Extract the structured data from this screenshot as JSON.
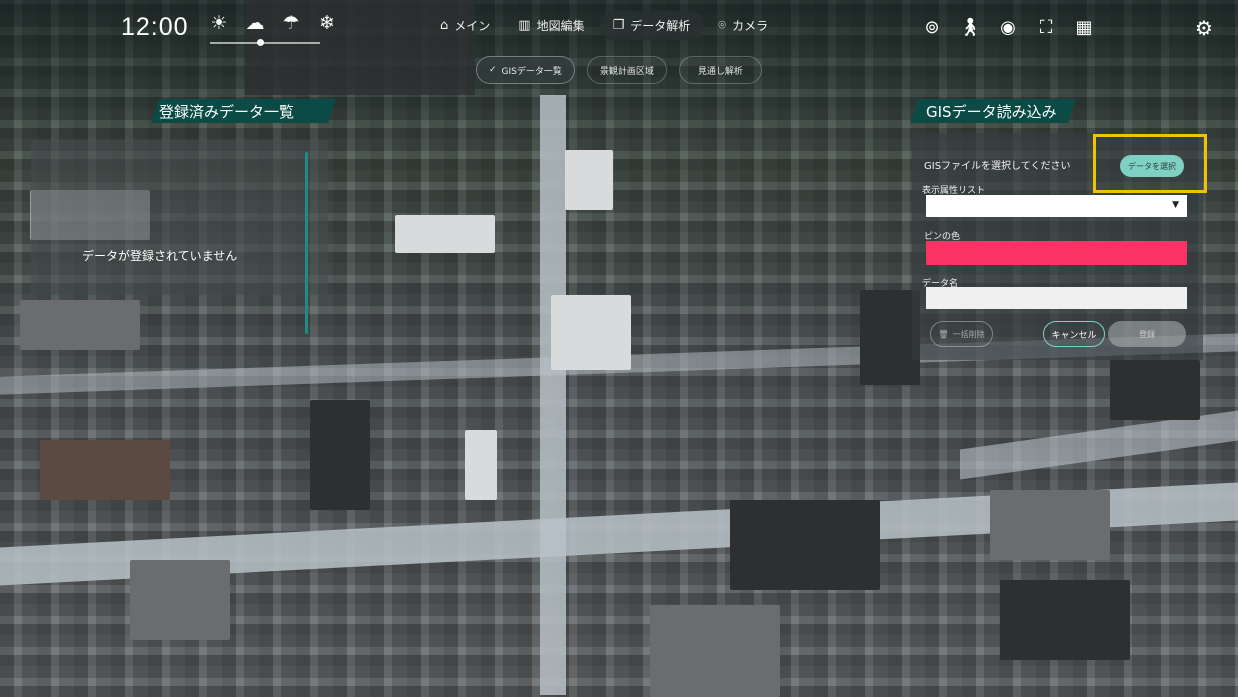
{
  "header": {
    "clock": "12:00",
    "weather_icons": [
      "sun-icon",
      "cloud-icon",
      "umbrella-icon",
      "snow-icon"
    ],
    "time_slider_level": 0.45
  },
  "main_tabs": [
    {
      "label": "メイン",
      "icon": "home-icon"
    },
    {
      "label": "地図編集",
      "icon": "building-icon"
    },
    {
      "label": "データ解析",
      "icon": "copy-icon",
      "active": true
    },
    {
      "label": "カメラ",
      "icon": "camera-icon"
    }
  ],
  "sub_tabs": [
    {
      "label": "GISデータ一覧",
      "active": true
    },
    {
      "label": "景観計画区域"
    },
    {
      "label": "見通し解析"
    }
  ],
  "right_icons": [
    "location-icon",
    "walk-icon",
    "eye-icon",
    "frame-icon",
    "building-grid-icon"
  ],
  "left_panel": {
    "title": "登録済みデータ一覧",
    "empty_message": "データが登録されていません"
  },
  "right_panel": {
    "title": "GISデータ読み込み",
    "file_label": "GISファイルを選択してください",
    "select_button": "データを選択",
    "attribute_label": "表示属性リスト",
    "attribute_value": "",
    "pin_color_label": "ピンの色",
    "pin_color": "#fb3264",
    "data_name_label": "データ名",
    "data_name_value": "",
    "delete_button": "一括削除",
    "cancel_button": "キャンセル",
    "register_button": "登録"
  },
  "colors": {
    "panel_header": "#0b4a45",
    "accent": "#7fd1c4",
    "highlight": "#f2c200"
  }
}
